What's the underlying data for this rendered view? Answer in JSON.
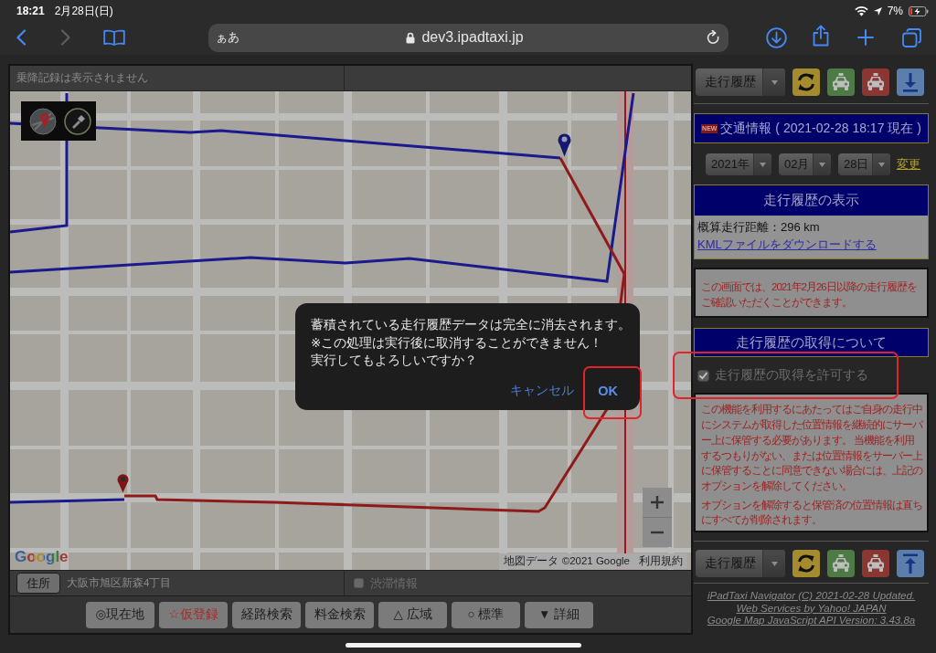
{
  "status_bar": {
    "time": "18:21",
    "date": "2月28日(日)",
    "battery": "7%"
  },
  "browser": {
    "nav": [
      {
        "kind": "back",
        "disabled": false
      },
      {
        "kind": "forward",
        "disabled": true
      }
    ],
    "text_size": "ぁあ",
    "url": "dev3.ipadtaxi.jp"
  },
  "map_panel": {
    "notice": "乗降記録は表示されません",
    "map": {
      "logo": "Google",
      "attribution": "地図データ ©2021 Google",
      "terms": "利用規約"
    },
    "address": {
      "button": "住所",
      "value": "大阪市旭区新森4丁目"
    },
    "traffic": {
      "label": "渋滞情報",
      "checked": false
    },
    "buttons": [
      {
        "label": "◎現在地",
        "kind": "normal"
      },
      {
        "label": "☆仮登録",
        "kind": "accent"
      },
      {
        "label": "経路検索",
        "kind": "normal"
      },
      {
        "label": "料金検索",
        "kind": "normal"
      },
      {
        "label": "△ 広域",
        "kind": "normal"
      },
      {
        "label": "○ 標準",
        "kind": "normal"
      },
      {
        "label": "▼ 詳細",
        "kind": "normal"
      }
    ]
  },
  "side_panel": {
    "top_toolbar": {
      "select": "走行履歴"
    },
    "traffic_banner": {
      "badge": "NEW",
      "text": "交通情報 ( 2021-02-28 18:17 現在 )"
    },
    "date": {
      "year": "2021年",
      "month": "02月",
      "day": "28日",
      "link": "変更"
    },
    "history_box": {
      "title": "走行履歴の表示",
      "distance": "概算走行距離：296 km",
      "link": "KMLファイルをダウンロードする"
    },
    "range_note": "この画面では、2021年2月26日以降の走行履歴をご確認いただくことができます。",
    "consent": {
      "title": "走行履歴の取得について",
      "checkbox": {
        "label": "走行履歴の取得を許可する",
        "checked": true,
        "highlighted": true
      },
      "paragraphs": [
        "この機能を利用するにあたってはご自身の走行中にシステムが取得した位置情報を継続的にサーバー上に保管する必要があります。 当機能を利用するつもりがない、または位置情報をサーバー上に保管することに同意できない場合には、上記のオプションを解除してください。",
        "オプションを解除すると保管済の位置情報は直ちにすべてが削除されます。"
      ]
    },
    "bottom_toolbar": {
      "select": "走行履歴"
    },
    "footer": [
      "iPadTaxi Navigator (C) 2021-02-28 Updated.",
      "Web Services by Yahoo! JAPAN",
      "Google Map JavaScript API Version: 3.43.8a"
    ]
  },
  "dialog": {
    "lines": [
      "蓄積されている走行履歴データは完全に消去されます。",
      "※この処理は実行後に取消することができません！",
      "実行してもよろしいですか？"
    ],
    "buttons": [
      {
        "label": "キャンセル",
        "kind": "cancel",
        "highlighted": false
      },
      {
        "label": "OK",
        "kind": "default",
        "highlighted": true
      }
    ]
  }
}
